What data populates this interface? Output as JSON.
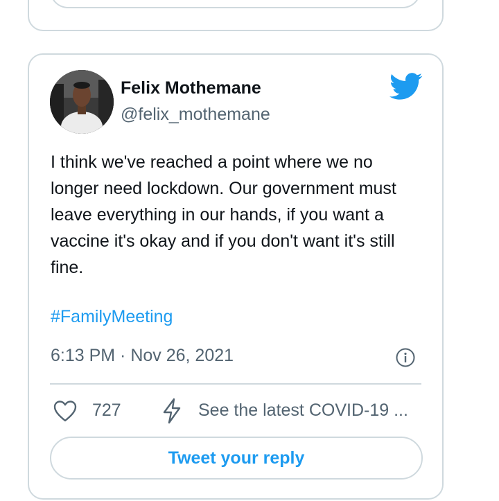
{
  "tweet": {
    "author_name": "Felix Mothemane",
    "author_handle": "@felix_mothemane",
    "text": "I think we've reached a point where we no longer need lockdown. Our government must leave everything in our hands, if you want a vaccine it's okay and if you don't want it's still fine.",
    "hashtag": "#FamilyMeeting",
    "timestamp": "6:13 PM · Nov 26, 2021",
    "like_count": "727",
    "covid_link": "See the latest COVID-19 ...",
    "reply_label": "Tweet your reply"
  },
  "colors": {
    "accent": "#1d9bf0",
    "text": "#0f1419",
    "muted": "#536471",
    "border": "#cfd9de"
  },
  "icons": {
    "logo": "twitter-bird-icon",
    "info": "info-icon",
    "like": "heart-icon",
    "covid": "lightning-bolt-icon"
  }
}
